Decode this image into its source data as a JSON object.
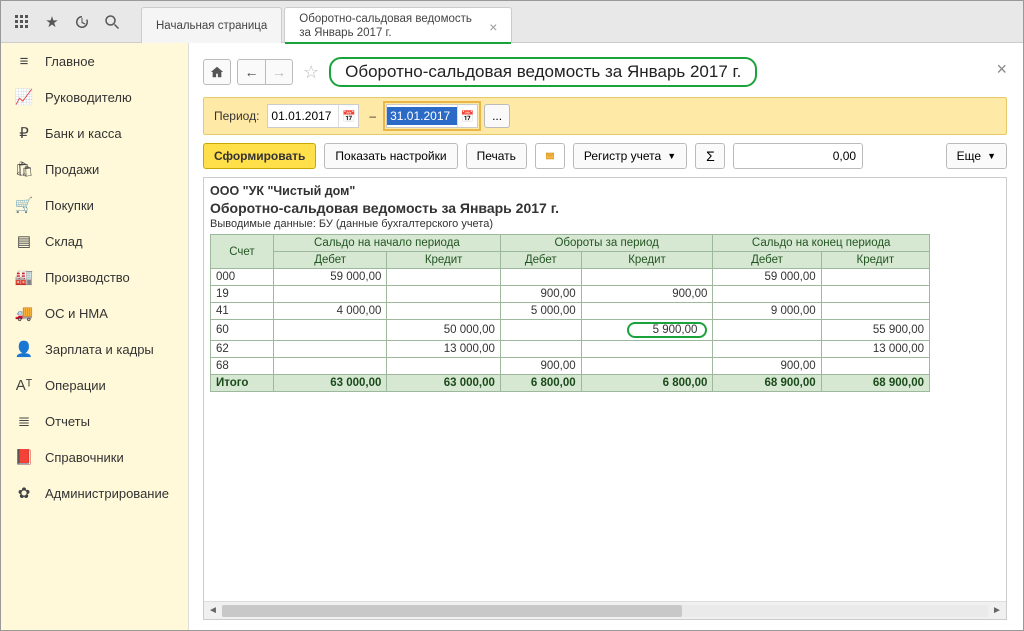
{
  "topbar": {
    "tabs": [
      {
        "label": "Начальная страница",
        "active": false,
        "closable": false
      },
      {
        "label": "Оборотно-сальдовая ведомость за Январь 2017 г.",
        "active": true,
        "closable": true
      }
    ]
  },
  "sidebar": {
    "items": [
      {
        "label": "Главное",
        "icon": "menu-icon"
      },
      {
        "label": "Руководителю",
        "icon": "chart-icon"
      },
      {
        "label": "Банк и касса",
        "icon": "ruble-icon"
      },
      {
        "label": "Продажи",
        "icon": "bag-icon"
      },
      {
        "label": "Покупки",
        "icon": "cart-icon"
      },
      {
        "label": "Склад",
        "icon": "warehouse-icon"
      },
      {
        "label": "Производство",
        "icon": "factory-icon"
      },
      {
        "label": "ОС и НМА",
        "icon": "truck-icon"
      },
      {
        "label": "Зарплата и кадры",
        "icon": "person-icon"
      },
      {
        "label": "Операции",
        "icon": "operations-icon"
      },
      {
        "label": "Отчеты",
        "icon": "reports-icon"
      },
      {
        "label": "Справочники",
        "icon": "book-icon"
      },
      {
        "label": "Администрирование",
        "icon": "gear-icon"
      }
    ]
  },
  "header": {
    "title": "Оборотно-сальдовая ведомость за Январь 2017 г."
  },
  "period": {
    "label": "Период:",
    "from": "01.01.2017",
    "to": "31.01.2017"
  },
  "actions": {
    "form": "Сформировать",
    "settings": "Показать настройки",
    "print": "Печать",
    "registry": "Регистр учета",
    "sum_value": "0,00",
    "more": "Еще"
  },
  "report": {
    "org": "ООО \"УК \"Чистый дом\"",
    "title": "Оборотно-сальдовая ведомость за Январь 2017 г.",
    "sub": "Выводимые данные:   БУ (данные бухгалтерского учета)",
    "colgroups": [
      "Счет",
      "Сальдо на начало периода",
      "Обороты за период",
      "Сальдо на конец периода"
    ],
    "subcols": [
      "Дебет",
      "Кредит"
    ],
    "rows": [
      {
        "acct": "000",
        "v": [
          "59 000,00",
          "",
          "",
          "",
          "59 000,00",
          ""
        ]
      },
      {
        "acct": "19",
        "v": [
          "",
          "",
          "900,00",
          "900,00",
          "",
          ""
        ]
      },
      {
        "acct": "41",
        "v": [
          "4 000,00",
          "",
          "5 000,00",
          "",
          "9 000,00",
          ""
        ]
      },
      {
        "acct": "60",
        "v": [
          "",
          "50 000,00",
          "",
          "5 900,00",
          "",
          "55 900,00"
        ],
        "highlight_col": 3
      },
      {
        "acct": "62",
        "v": [
          "",
          "13 000,00",
          "",
          "",
          "",
          "13 000,00"
        ]
      },
      {
        "acct": "68",
        "v": [
          "",
          "",
          "900,00",
          "",
          "900,00",
          ""
        ]
      }
    ],
    "total": {
      "label": "Итого",
      "v": [
        "63 000,00",
        "63 000,00",
        "6 800,00",
        "6 800,00",
        "68 900,00",
        "68 900,00"
      ]
    }
  },
  "chart_data": {
    "type": "table",
    "title": "Оборотно-сальдовая ведомость за Январь 2017 г.",
    "columns": [
      "Счет",
      "Сальдо на начало периода — Дебет",
      "Сальдо на начало периода — Кредит",
      "Обороты за период — Дебет",
      "Обороты за период — Кредит",
      "Сальдо на конец периода — Дебет",
      "Сальдо на конец периода — Кредит"
    ],
    "rows": [
      [
        "000",
        59000.0,
        null,
        null,
        null,
        59000.0,
        null
      ],
      [
        "19",
        null,
        null,
        900.0,
        900.0,
        null,
        null
      ],
      [
        "41",
        4000.0,
        null,
        5000.0,
        null,
        9000.0,
        null
      ],
      [
        "60",
        null,
        50000.0,
        null,
        5900.0,
        null,
        55900.0
      ],
      [
        "62",
        null,
        13000.0,
        null,
        null,
        null,
        13000.0
      ],
      [
        "68",
        null,
        null,
        900.0,
        null,
        900.0,
        null
      ],
      [
        "Итого",
        63000.0,
        63000.0,
        6800.0,
        6800.0,
        68900.0,
        68900.0
      ]
    ]
  }
}
